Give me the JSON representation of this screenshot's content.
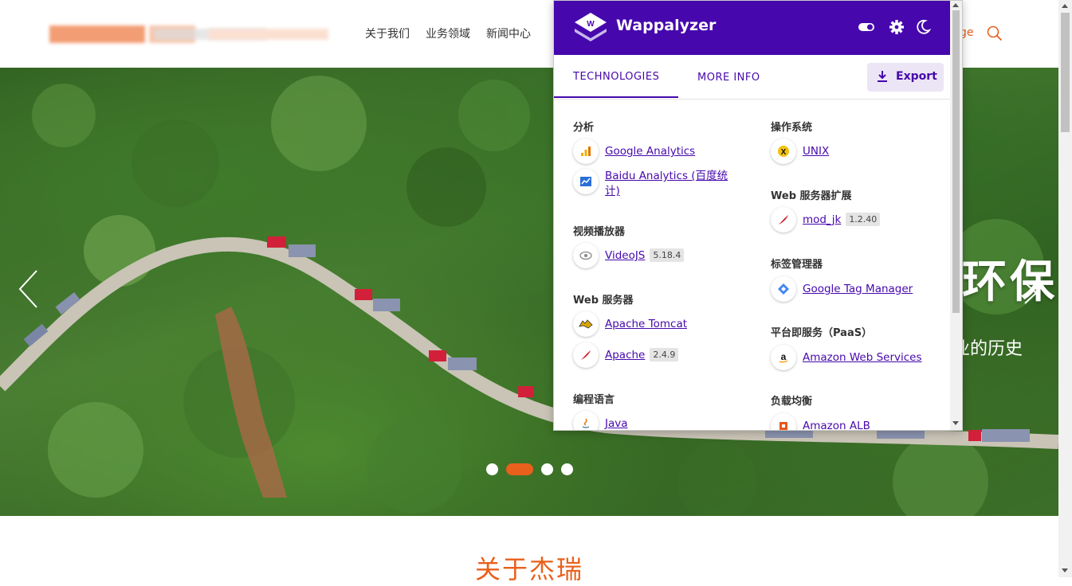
{
  "site": {
    "nav": [
      "关于我们",
      "业务领域",
      "新闻中心"
    ],
    "lang_fragment": "ge",
    "hero_title": "环保",
    "hero_subtitle": "业的历史",
    "about_title": "关于杰瑞",
    "carousel": {
      "count": 4,
      "active_index": 1
    }
  },
  "popup": {
    "brand": "Wappalyzer",
    "tabs": {
      "technologies": "TECHNOLOGIES",
      "more_info": "MORE INFO"
    },
    "export_label": "Export",
    "left_column": [
      {
        "category": "分析",
        "items": [
          {
            "name": "Google Analytics",
            "icon": "google-analytics-icon"
          },
          {
            "name": "Baidu Analytics (百度统计)",
            "icon": "baidu-analytics-icon"
          }
        ]
      },
      {
        "category": "视频播放器",
        "items": [
          {
            "name": "VideoJS",
            "version": "5.18.4",
            "icon": "videojs-icon"
          }
        ]
      },
      {
        "category": "Web 服务器",
        "items": [
          {
            "name": "Apache Tomcat",
            "icon": "tomcat-icon"
          },
          {
            "name": "Apache",
            "version": "2.4.9",
            "icon": "apache-feather-icon"
          }
        ]
      },
      {
        "category": "编程语言",
        "items": [
          {
            "name": "Java",
            "icon": "java-icon"
          }
        ]
      }
    ],
    "right_column": [
      {
        "category": "操作系统",
        "items": [
          {
            "name": "UNIX",
            "icon": "unix-icon"
          }
        ]
      },
      {
        "category": "Web 服务器扩展",
        "items": [
          {
            "name": "mod_jk",
            "version": "1.2.40",
            "icon": "apache-feather-icon"
          }
        ]
      },
      {
        "category": "标签管理器",
        "items": [
          {
            "name": "Google Tag Manager",
            "icon": "google-tag-manager-icon"
          }
        ]
      },
      {
        "category": "平台即服务（PaaS）",
        "items": [
          {
            "name": "Amazon Web Services",
            "icon": "amazon-icon"
          }
        ]
      },
      {
        "category": "负载均衡",
        "items": [
          {
            "name": "Amazon ALB",
            "icon": "amazon-alb-icon"
          }
        ]
      }
    ]
  }
}
